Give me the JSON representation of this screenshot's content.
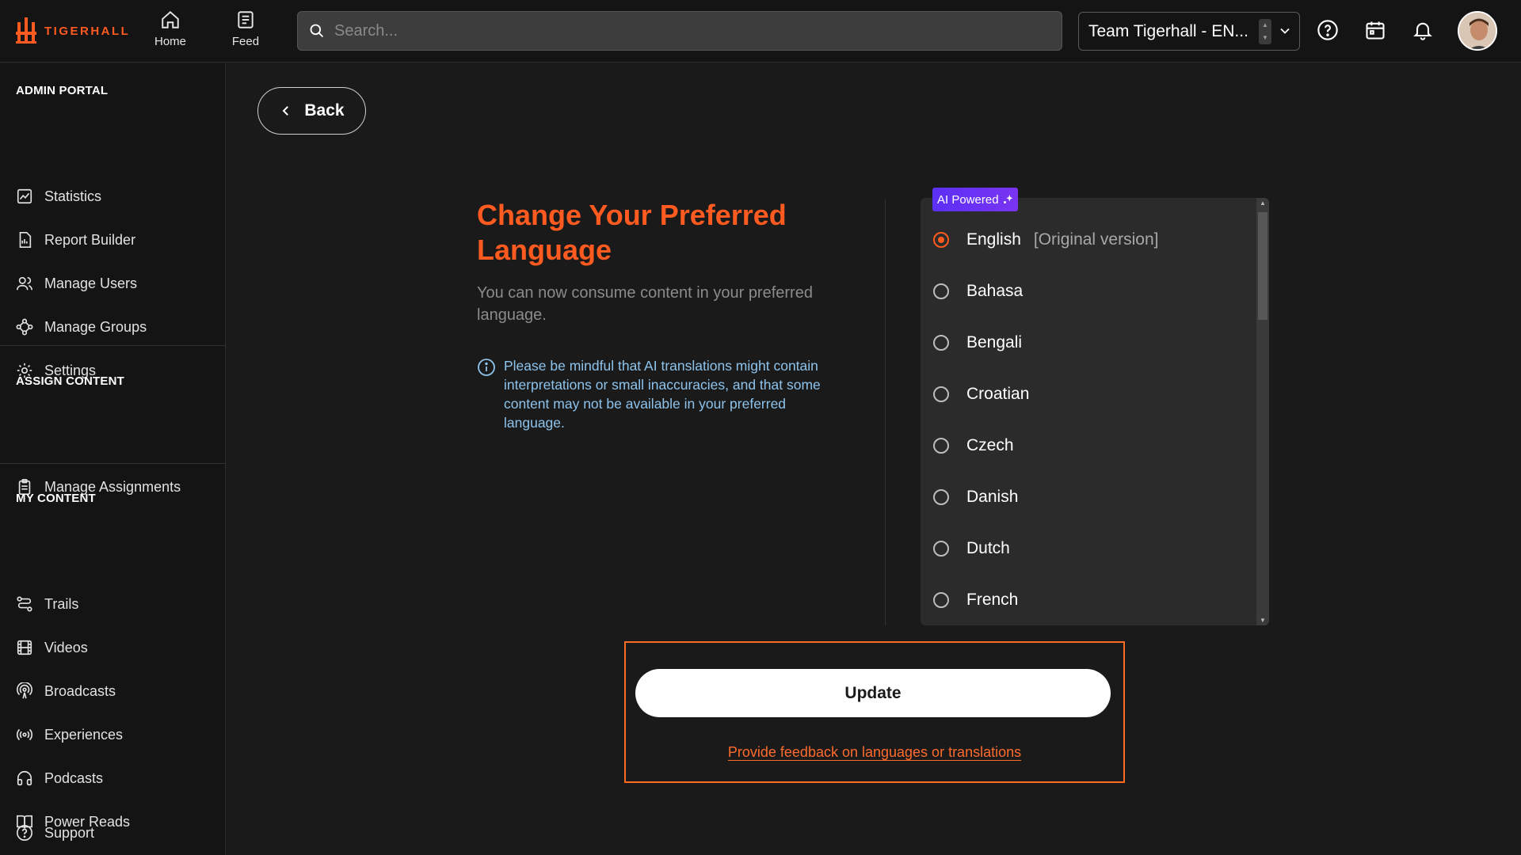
{
  "header": {
    "brand": "TIGERHALL",
    "nav": [
      {
        "label": "Home",
        "icon": "home-icon"
      },
      {
        "label": "Feed",
        "icon": "feed-icon"
      }
    ],
    "search_placeholder": "Search...",
    "team_selector": "Team Tigerhall - EN...",
    "icons": [
      "help-icon",
      "calendar-icon",
      "bell-icon"
    ]
  },
  "sidebar": {
    "admin_title": "ADMIN PORTAL",
    "admin_items": [
      "Statistics",
      "Report Builder",
      "Manage Users",
      "Manage Groups",
      "Settings"
    ],
    "assign_title": "ASSIGN CONTENT",
    "assign_items": [
      "Manage Assignments"
    ],
    "content_title": "MY CONTENT",
    "content_items": [
      "Trails",
      "Videos",
      "Broadcasts",
      "Experiences",
      "Podcasts",
      "Power Reads"
    ],
    "support": "Support"
  },
  "main": {
    "back_label": "Back",
    "title": "Change Your Preferred Language",
    "subtitle": "You can now consume content in your preferred language.",
    "info": "Please be mindful that AI translations might contain interpretations or small inaccuracies, and that some content may not be available in your preferred language.",
    "ai_badge": "AI Powered",
    "languages": [
      {
        "name": "English",
        "note": "[Original version]",
        "selected": true
      },
      {
        "name": "Bahasa",
        "selected": false
      },
      {
        "name": "Bengali",
        "selected": false
      },
      {
        "name": "Croatian",
        "selected": false
      },
      {
        "name": "Czech",
        "selected": false
      },
      {
        "name": "Danish",
        "selected": false
      },
      {
        "name": "Dutch",
        "selected": false
      },
      {
        "name": "French",
        "selected": false
      }
    ],
    "update_label": "Update",
    "feedback_link": "Provide feedback on languages or translations"
  },
  "colors": {
    "accent": "#ff5a1f",
    "info_text": "#8ec3ec",
    "ai_badge": "#6a32f4",
    "background": "#1a1a1a"
  }
}
